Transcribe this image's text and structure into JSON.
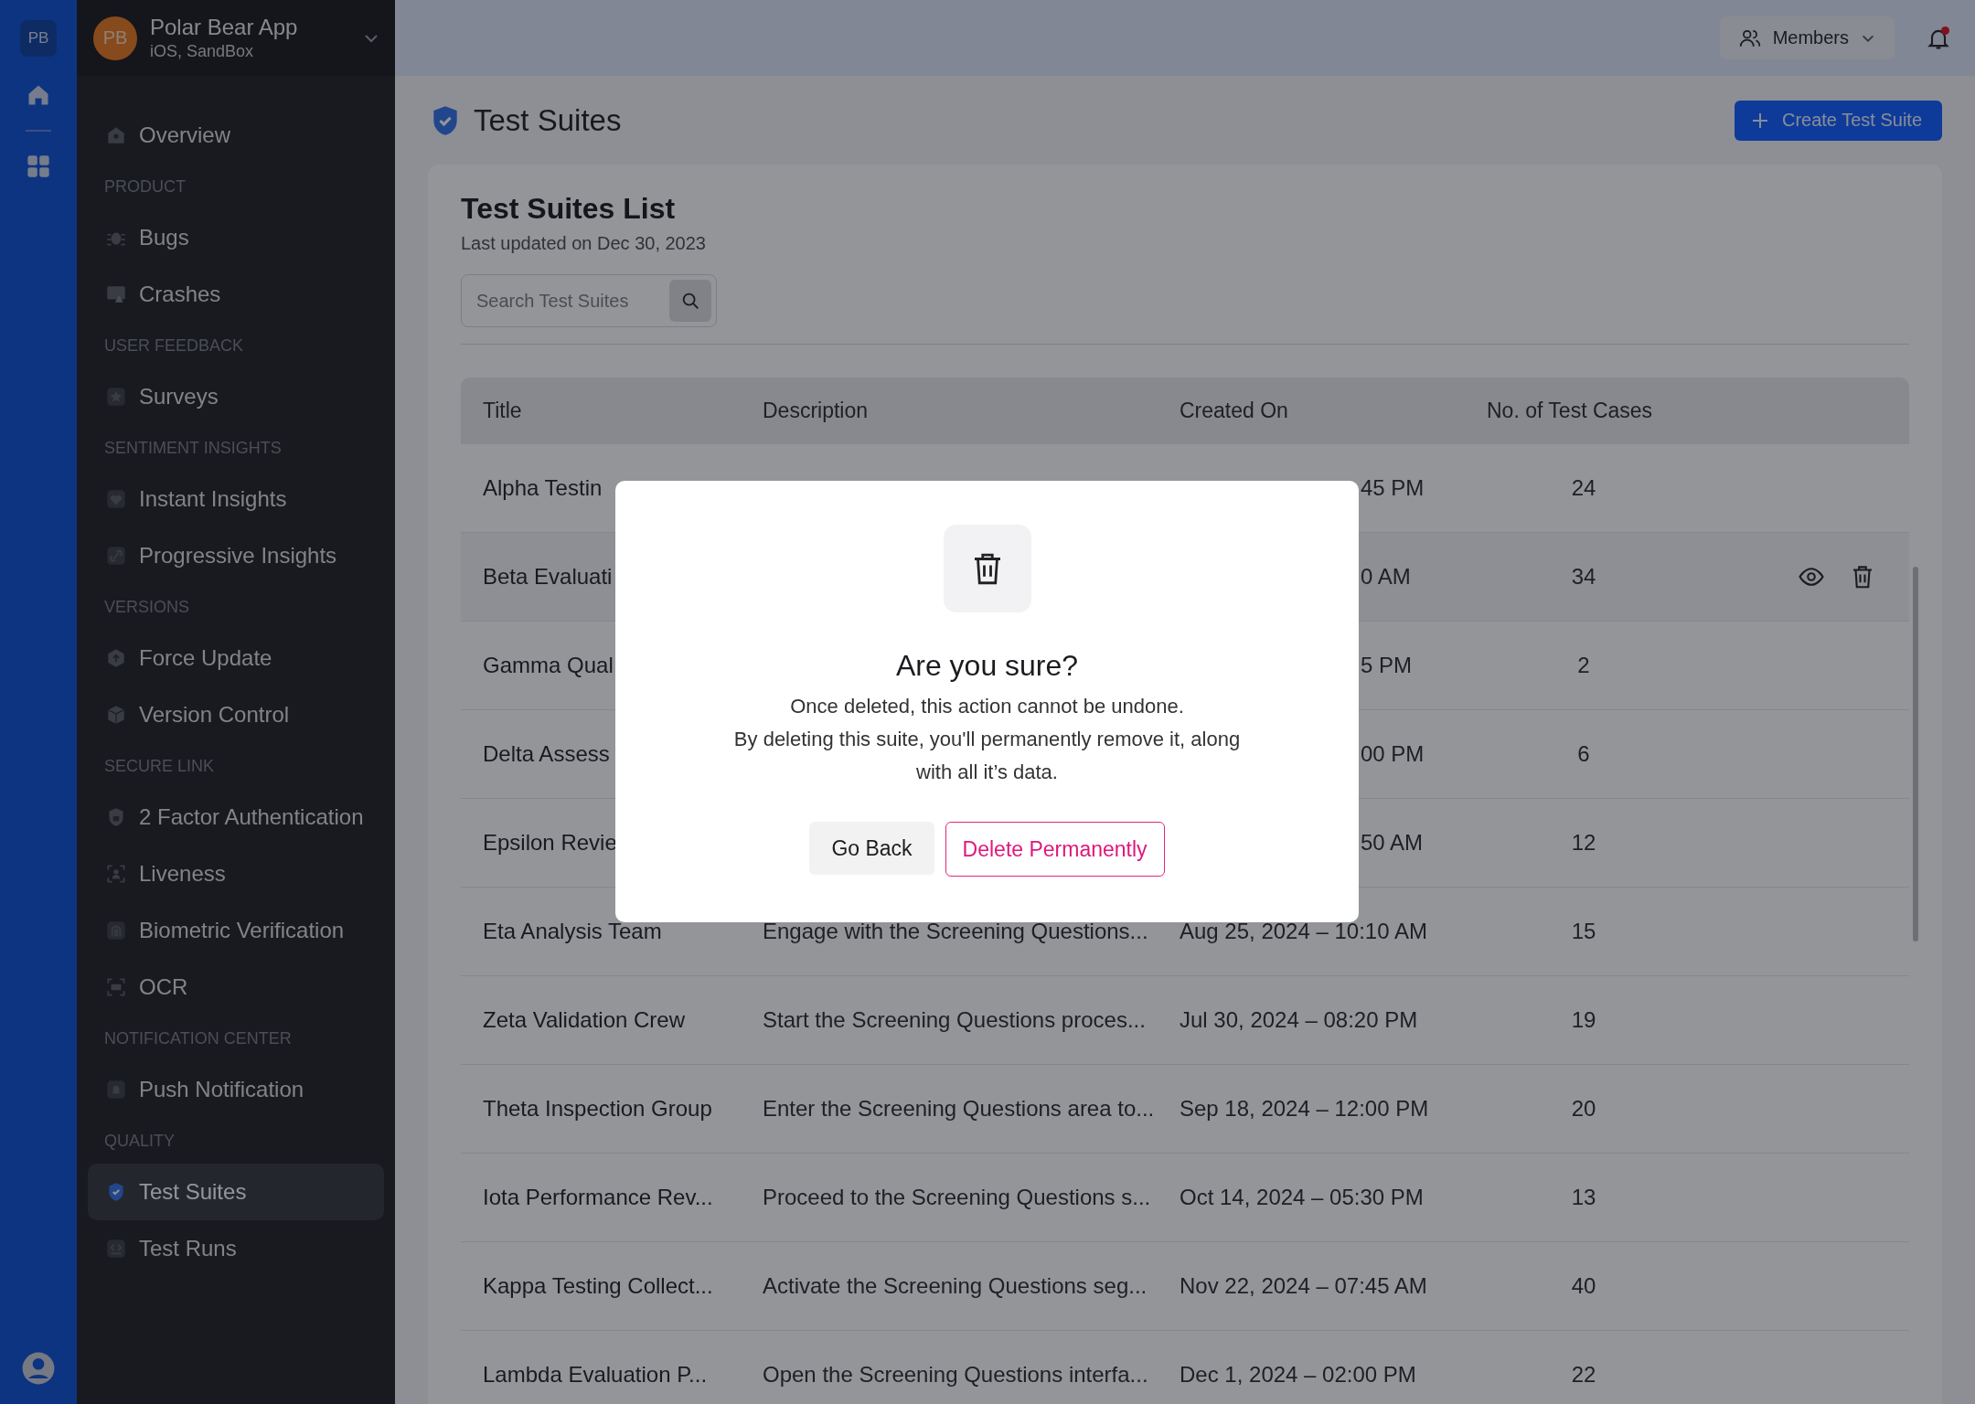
{
  "rail": {
    "badge": "PB"
  },
  "app": {
    "avatar": "PB",
    "name": "Polar Bear App",
    "subtitle": "iOS, SandBox"
  },
  "nav": [
    {
      "items": [
        {
          "label": "Overview",
          "selected": false
        }
      ]
    },
    {
      "heading": "PRODUCT",
      "items": [
        {
          "label": "Bugs",
          "selected": false
        },
        {
          "label": "Crashes",
          "selected": false
        }
      ]
    },
    {
      "heading": "USER FEEDBACK",
      "items": [
        {
          "label": "Surveys",
          "selected": false
        }
      ]
    },
    {
      "heading": "SENTIMENT INSIGHTS",
      "items": [
        {
          "label": "Instant Insights",
          "selected": false
        },
        {
          "label": "Progressive Insights",
          "selected": false
        }
      ]
    },
    {
      "heading": "VERSIONS",
      "items": [
        {
          "label": "Force Update",
          "selected": false
        },
        {
          "label": "Version Control",
          "selected": false
        }
      ]
    },
    {
      "heading": "SECURE LINK",
      "items": [
        {
          "label": "2 Factor Authentication",
          "selected": false
        },
        {
          "label": "Liveness",
          "selected": false
        },
        {
          "label": "Biometric Verification",
          "selected": false
        },
        {
          "label": "OCR",
          "selected": false
        }
      ]
    },
    {
      "heading": "NOTIFICATION CENTER",
      "items": [
        {
          "label": "Push Notification",
          "selected": false
        }
      ]
    },
    {
      "heading": "QUALITY",
      "items": [
        {
          "label": "Test Suites",
          "selected": true
        },
        {
          "label": "Test Runs",
          "selected": false
        }
      ]
    }
  ],
  "header": {
    "members": "Members",
    "notification_dot": true
  },
  "page": {
    "title": "Test Suites",
    "create_button": "Create Test Suite"
  },
  "list": {
    "title": "Test Suites List",
    "updated": "Last updated on Dec 30, 2023",
    "search": {
      "placeholder": "Search Test Suites"
    },
    "columns": [
      "Title",
      "Description",
      "Created On",
      "No. of Test Cases"
    ],
    "rows": [
      {
        "kind": "covered",
        "title": "Alpha Testin",
        "created": "45 PM",
        "count": "24",
        "hovered": false
      },
      {
        "kind": "covered",
        "title": "Beta Evaluati",
        "created": "0 AM",
        "count": "34",
        "hovered": true
      },
      {
        "kind": "covered",
        "title": "Gamma Qual",
        "created": "5 PM",
        "count": "2",
        "hovered": false
      },
      {
        "kind": "covered",
        "title": "Delta Assess",
        "created": "00 PM",
        "count": "6",
        "hovered": false
      },
      {
        "kind": "covered",
        "title": "Epsilon Revie",
        "created": "50 AM",
        "count": "12",
        "hovered": false
      },
      {
        "kind": "full",
        "title": "Eta Analysis Team",
        "description": "Engage with the Screening Questions...",
        "created": "Aug 25, 2024 – 10:10 AM",
        "count": "15",
        "hovered": false
      },
      {
        "kind": "full",
        "title": "Zeta Validation Crew",
        "description": "Start the Screening Questions proces...",
        "created": "Jul 30, 2024 – 08:20 PM",
        "count": "19",
        "hovered": false
      },
      {
        "kind": "full",
        "title": "Theta Inspection Group",
        "description": "Enter the Screening Questions area to...",
        "created": "Sep 18, 2024 – 12:00 PM",
        "count": "20",
        "hovered": false
      },
      {
        "kind": "full",
        "title": "Iota Performance Rev...",
        "description": "Proceed to the Screening Questions s...",
        "created": "Oct 14, 2024 – 05:30 PM",
        "count": "13",
        "hovered": false
      },
      {
        "kind": "full",
        "title": "Kappa Testing Collect...",
        "description": "Activate the Screening Questions seg...",
        "created": "Nov 22, 2024 – 07:45 AM",
        "count": "40",
        "hovered": false
      },
      {
        "kind": "full",
        "title": "Lambda Evaluation P...",
        "description": "Open the Screening Questions interfa...",
        "created": "Dec 1, 2024 – 02:00 PM",
        "count": "22",
        "hovered": false
      }
    ]
  },
  "dialog": {
    "title": "Are you sure?",
    "lines": [
      "Once deleted, this action cannot be undone.",
      "By deleting this suite, you'll permanently remove it, along",
      "with all it’s data."
    ],
    "cancel": "Go Back",
    "confirm": "Delete Permanently"
  }
}
